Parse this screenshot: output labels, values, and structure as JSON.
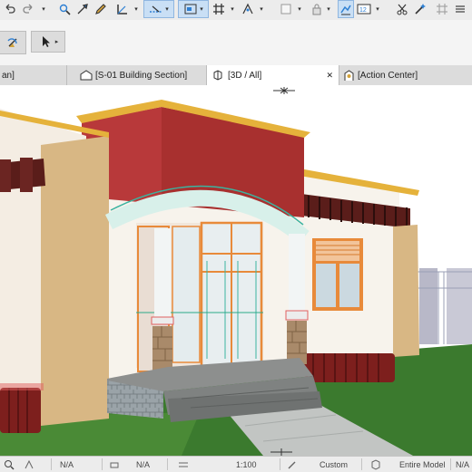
{
  "tabs": [
    {
      "label": "an]"
    },
    {
      "label": "[S-01 Building Section]"
    },
    {
      "label": "[3D / All]"
    },
    {
      "label": "[Action Center]"
    }
  ],
  "close_glyph": "✕",
  "status": {
    "first_na": "N/A",
    "second_na": "N/A",
    "scale": "1:100",
    "custom": "Custom",
    "model": "Entire Model",
    "last_na": "N/A"
  },
  "colors": {
    "accent": "#2d7fd3",
    "wall_red": "#b8393a",
    "stucco": "#d8b784",
    "grass": "#3b7a2e"
  },
  "icons": [
    "undo-icon",
    "redo-icon",
    "pick-icon",
    "eyedropper-icon",
    "pen-icon",
    "ruler-icon",
    "guideline-icon",
    "layout-icon",
    "grid-icon",
    "snap-icon",
    "layer-icon",
    "lock-icon",
    "render-icon",
    "number-icon",
    "scissors-icon",
    "magic-wand-icon",
    "rotate-icon",
    "arrow-icon",
    "section-icon",
    "3d-box-icon",
    "building-icon",
    "zoom-icon",
    "print-icon",
    "grid-settings-icon",
    "layer-settings-icon",
    "pen-set-icon",
    "options-icon"
  ]
}
